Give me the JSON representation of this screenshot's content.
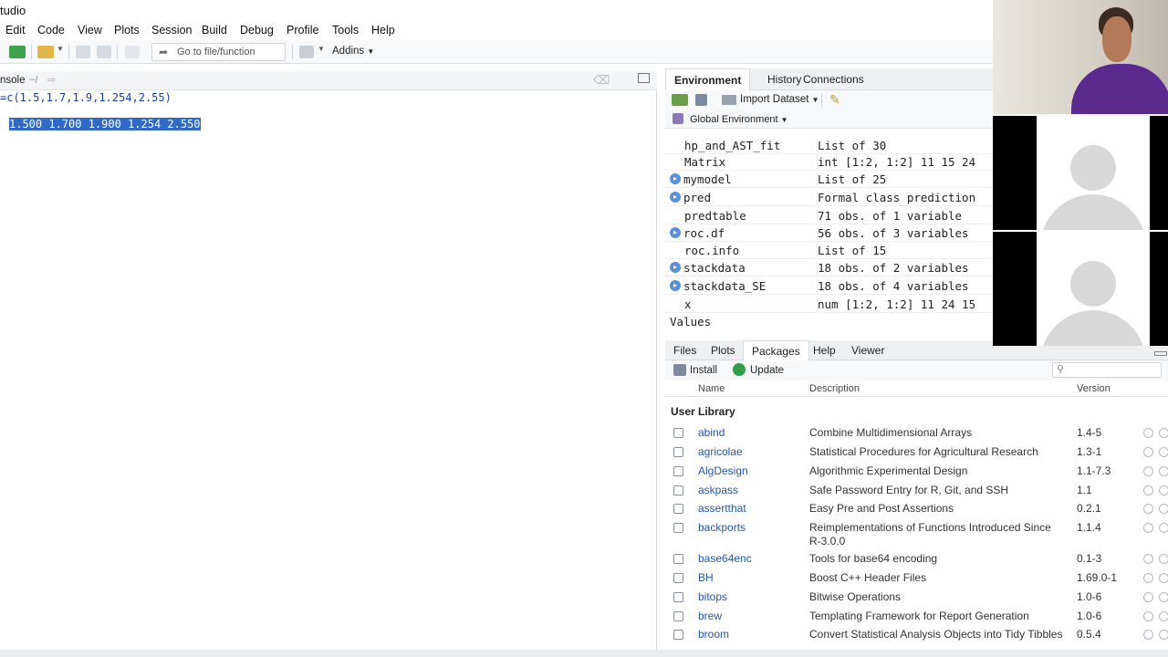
{
  "app": {
    "title": "tudio"
  },
  "menu": [
    "Edit",
    "Code",
    "View",
    "Plots",
    "Session",
    "Build",
    "Debug",
    "Profile",
    "Tools",
    "Help"
  ],
  "toolbar": {
    "goto_placeholder": "Go to file/function",
    "addins_label": "Addins"
  },
  "console": {
    "tab_label": "nsole",
    "path": "~/",
    "lines": [
      "=c(1.5,1.7,1.9,1.254,2.55)",
      "",
      "1.500 1.700 1.900 1.254 2.550"
    ]
  },
  "environment": {
    "tabs": [
      "Environment",
      "History",
      "Connections"
    ],
    "import_label": "Import Dataset",
    "scope_label": "Global Environment",
    "rows": [
      {
        "name": "hp_and_AST_fit",
        "value": "List of 30",
        "expandable": false
      },
      {
        "name": "Matrix",
        "value": "int [1:2, 1:2] 11 15 24 ",
        "expandable": false
      },
      {
        "name": "mymodel",
        "value": "List of 25",
        "expandable": true
      },
      {
        "name": "pred",
        "value": "Formal class prediction",
        "expandable": true
      },
      {
        "name": "predtable",
        "value": "71 obs. of 1 variable",
        "expandable": false
      },
      {
        "name": "roc.df",
        "value": "56 obs. of 3 variables",
        "expandable": true
      },
      {
        "name": "roc.info",
        "value": "List of 15",
        "expandable": false
      },
      {
        "name": "stackdata",
        "value": "18 obs. of 2 variables",
        "expandable": true
      },
      {
        "name": "stackdata_SE",
        "value": "18 obs. of 4 variables",
        "expandable": true
      },
      {
        "name": "x",
        "value": "num [1:2, 1:2] 11 24 15 ",
        "expandable": false
      }
    ],
    "values_header": "Values"
  },
  "files": {
    "tabs": [
      "Files",
      "Plots",
      "Packages",
      "Help",
      "Viewer"
    ],
    "install_label": "Install",
    "update_label": "Update",
    "columns": [
      "Name",
      "Description",
      "Version"
    ],
    "section": "User Library",
    "packages": [
      {
        "name": "abind",
        "desc": "Combine Multidimensional Arrays",
        "version": "1.4-5"
      },
      {
        "name": "agricolae",
        "desc": "Statistical Procedures for Agricultural Research",
        "version": "1.3-1"
      },
      {
        "name": "AlgDesign",
        "desc": "Algorithmic Experimental Design",
        "version": "1.1-7.3"
      },
      {
        "name": "askpass",
        "desc": "Safe Password Entry for R, Git, and SSH",
        "version": "1.1"
      },
      {
        "name": "assertthat",
        "desc": "Easy Pre and Post Assertions",
        "version": "0.2.1"
      },
      {
        "name": "backports",
        "desc": "Reimplementations of Functions Introduced Since R-3.0.0",
        "version": "1.1.4"
      },
      {
        "name": "base64enc",
        "desc": "Tools for base64 encoding",
        "version": "0.1-3"
      },
      {
        "name": "BH",
        "desc": "Boost C++ Header Files",
        "version": "1.69.0-1"
      },
      {
        "name": "bitops",
        "desc": "Bitwise Operations",
        "version": "1.0-6"
      },
      {
        "name": "brew",
        "desc": "Templating Framework for Report Generation",
        "version": "1.0-6"
      },
      {
        "name": "broom",
        "desc": "Convert Statistical Analysis Objects into Tidy Tibbles",
        "version": "0.5.4"
      }
    ]
  },
  "colors": {
    "selection": "#3169c6",
    "link": "#2456a6",
    "accent": "#5b8fd8"
  }
}
